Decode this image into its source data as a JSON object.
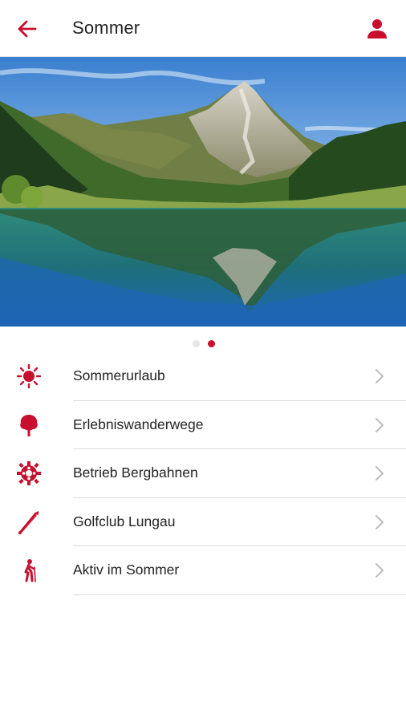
{
  "appbar": {
    "title": "Sommer",
    "back_icon": "arrow-left-icon",
    "profile_icon": "person-icon"
  },
  "colors": {
    "accent": "#c8102e",
    "text": "#222222",
    "divider": "#dcdcdc"
  },
  "carousel": {
    "page_count": 2,
    "active_index": 1
  },
  "menu": {
    "items": [
      {
        "label": "Sommerurlaub",
        "icon": "sun-icon"
      },
      {
        "label": "Erlebniswanderwege",
        "icon": "tree-icon"
      },
      {
        "label": "Betrieb Bergbahnen",
        "icon": "cog-wheel-icon"
      },
      {
        "label": "Golfclub Lungau",
        "icon": "golf-icon"
      },
      {
        "label": "Aktiv im Sommer",
        "icon": "hiker-icon"
      }
    ]
  }
}
